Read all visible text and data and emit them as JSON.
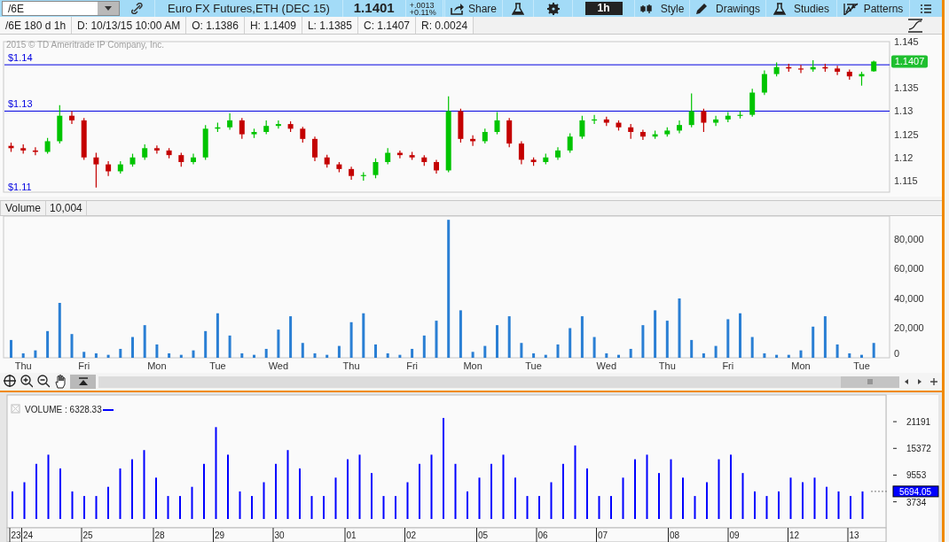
{
  "toolbar": {
    "symbol": "/6E",
    "instrument": "Euro FX Futures,ETH (DEC 15)",
    "last": "1.1401",
    "change": "+.0013",
    "change_pct": "+0.11%",
    "share": "Share",
    "timeframe": "1h",
    "menus": [
      "Style",
      "Drawings",
      "Studies",
      "Patterns"
    ]
  },
  "info_row": [
    "/6E 180 d 1h",
    "D: 10/13/15 10:00 AM",
    "O: 1.1386",
    "H: 1.1409",
    "L: 1.1385",
    "C: 1.1407",
    "R: 0.0024"
  ],
  "price_chart": {
    "copyright": "2015 © TD Ameritrade IP Company, Inc.",
    "price_tag": "1.1407",
    "bottom_label": "$1.11",
    "chart_data": {
      "type": "candlestick",
      "ref_lines": [
        {
          "axis": "y",
          "value": 1.14,
          "label": "$1.14"
        },
        {
          "axis": "y",
          "value": 1.13,
          "label": "$1.13"
        }
      ],
      "ohlc": [
        [
          1.1225,
          1.1232,
          1.1212,
          1.122
        ],
        [
          1.122,
          1.1228,
          1.1208,
          1.1215
        ],
        [
          1.1215,
          1.1222,
          1.1205,
          1.1212
        ],
        [
          1.1212,
          1.1242,
          1.1208,
          1.1235
        ],
        [
          1.1235,
          1.1313,
          1.123,
          1.129
        ],
        [
          1.129,
          1.13,
          1.1272,
          1.128
        ],
        [
          1.128,
          1.1285,
          1.1195,
          1.12
        ],
        [
          1.12,
          1.121,
          1.1135,
          1.1185
        ],
        [
          1.1185,
          1.1192,
          1.116,
          1.117
        ],
        [
          1.117,
          1.1192,
          1.1165,
          1.1185
        ],
        [
          1.1185,
          1.1208,
          1.118,
          1.12
        ],
        [
          1.12,
          1.1228,
          1.1195,
          1.122
        ],
        [
          1.122,
          1.1226,
          1.1208,
          1.1215
        ],
        [
          1.1215,
          1.122,
          1.1198,
          1.1205
        ],
        [
          1.1205,
          1.121,
          1.118,
          1.119
        ],
        [
          1.119,
          1.1208,
          1.1185,
          1.12
        ],
        [
          1.12,
          1.127,
          1.1195,
          1.1262
        ],
        [
          1.1262,
          1.1275,
          1.1255,
          1.1265
        ],
        [
          1.1265,
          1.1295,
          1.126,
          1.128
        ],
        [
          1.128,
          1.1285,
          1.124,
          1.125
        ],
        [
          1.125,
          1.1262,
          1.1242,
          1.1255
        ],
        [
          1.1255,
          1.128,
          1.125,
          1.1268
        ],
        [
          1.1268,
          1.128,
          1.1262,
          1.1272
        ],
        [
          1.1272,
          1.1278,
          1.1255,
          1.1262
        ],
        [
          1.1262,
          1.1266,
          1.1232,
          1.124
        ],
        [
          1.124,
          1.1245,
          1.1192,
          1.12
        ],
        [
          1.12,
          1.1206,
          1.1178,
          1.1185
        ],
        [
          1.1185,
          1.119,
          1.1168,
          1.1175
        ],
        [
          1.1175,
          1.118,
          1.1152,
          1.116
        ],
        [
          1.116,
          1.1168,
          1.115,
          1.1162
        ],
        [
          1.1162,
          1.1198,
          1.1155,
          1.119
        ],
        [
          1.119,
          1.122,
          1.1185,
          1.121
        ],
        [
          1.121,
          1.1215,
          1.1198,
          1.1205
        ],
        [
          1.1205,
          1.1212,
          1.1195,
          1.12
        ],
        [
          1.12,
          1.1205,
          1.1182,
          1.119
        ],
        [
          1.119,
          1.1195,
          1.1165,
          1.1172
        ],
        [
          1.1172,
          1.1332,
          1.1168,
          1.13
        ],
        [
          1.13,
          1.1305,
          1.1232,
          1.124
        ],
        [
          1.124,
          1.1248,
          1.1225,
          1.1235
        ],
        [
          1.1235,
          1.1262,
          1.123,
          1.1255
        ],
        [
          1.1255,
          1.1298,
          1.125,
          1.128
        ],
        [
          1.128,
          1.1285,
          1.1222,
          1.123
        ],
        [
          1.123,
          1.1235,
          1.1185,
          1.1195
        ],
        [
          1.1195,
          1.12,
          1.1182,
          1.119
        ],
        [
          1.119,
          1.1208,
          1.1185,
          1.12
        ],
        [
          1.12,
          1.1222,
          1.1195,
          1.1215
        ],
        [
          1.1215,
          1.1252,
          1.121,
          1.1245
        ],
        [
          1.1245,
          1.129,
          1.124,
          1.128
        ],
        [
          1.128,
          1.1292,
          1.1272,
          1.1282
        ],
        [
          1.1282,
          1.1288,
          1.1268,
          1.1275
        ],
        [
          1.1275,
          1.128,
          1.1258,
          1.1265
        ],
        [
          1.1265,
          1.1272,
          1.124,
          1.1255
        ],
        [
          1.1255,
          1.126,
          1.1238,
          1.1245
        ],
        [
          1.1245,
          1.1258,
          1.124,
          1.125
        ],
        [
          1.125,
          1.1265,
          1.1245,
          1.1258
        ],
        [
          1.1258,
          1.128,
          1.1252,
          1.127
        ],
        [
          1.127,
          1.1338,
          1.1265,
          1.13
        ],
        [
          1.13,
          1.1305,
          1.1255,
          1.1275
        ],
        [
          1.1275,
          1.129,
          1.1268,
          1.1282
        ],
        [
          1.1282,
          1.1298,
          1.1276,
          1.129
        ],
        [
          1.129,
          1.13,
          1.1284,
          1.1292
        ],
        [
          1.1292,
          1.1348,
          1.1288,
          1.134
        ],
        [
          1.134,
          1.1388,
          1.1335,
          1.138
        ],
        [
          1.138,
          1.1405,
          1.1375,
          1.1395
        ],
        [
          1.1395,
          1.1402,
          1.1385,
          1.1392
        ],
        [
          1.1392,
          1.14,
          1.1382,
          1.139
        ],
        [
          1.139,
          1.141,
          1.1385,
          1.1395
        ],
        [
          1.1395,
          1.1402,
          1.1385,
          1.1392
        ],
        [
          1.1392,
          1.1398,
          1.1378,
          1.1385
        ],
        [
          1.1385,
          1.139,
          1.1368,
          1.1375
        ],
        [
          1.1375,
          1.1385,
          1.1355,
          1.138
        ],
        [
          1.1386,
          1.1409,
          1.1385,
          1.1407
        ]
      ],
      "ylim": [
        1.1125,
        1.145
      ],
      "yticks": [
        {
          "value": 1.145,
          "label": "1.145"
        },
        {
          "value": 1.135,
          "label": "1.135"
        },
        {
          "value": 1.13,
          "label": "1.13"
        },
        {
          "value": 1.125,
          "label": "1.125"
        },
        {
          "value": 1.12,
          "label": "1.12"
        },
        {
          "value": 1.115,
          "label": "1.115"
        }
      ]
    }
  },
  "volume_panel": {
    "title": "Volume",
    "value": "10,004",
    "chart_data": {
      "type": "bar",
      "categories": [
        null,
        "Thu",
        null,
        null,
        null,
        null,
        "Fri",
        null,
        null,
        null,
        null,
        null,
        "Mon",
        null,
        null,
        null,
        null,
        "Tue",
        null,
        null,
        null,
        null,
        "Wed",
        null,
        null,
        null,
        null,
        null,
        "Thu",
        null,
        null,
        null,
        null,
        "Fri",
        null,
        null,
        null,
        null,
        "Mon",
        null,
        null,
        null,
        null,
        "Tue",
        null,
        null,
        null,
        null,
        null,
        "Wed",
        null,
        null,
        null,
        null,
        "Thu",
        null,
        null,
        null,
        null,
        "Fri",
        null,
        null,
        null,
        null,
        null,
        "Mon",
        null,
        null,
        null,
        null,
        "Tue",
        null
      ],
      "values": [
        12000,
        3000,
        5000,
        18000,
        37000,
        16000,
        4000,
        3000,
        2000,
        6000,
        14000,
        22000,
        9000,
        3000,
        2000,
        5000,
        18000,
        30000,
        15000,
        3000,
        2000,
        6000,
        19000,
        28000,
        10000,
        3000,
        2000,
        8000,
        24000,
        30000,
        9000,
        3000,
        2000,
        6000,
        15000,
        25000,
        93000,
        32000,
        4000,
        8000,
        22000,
        28000,
        10000,
        3000,
        2000,
        9000,
        20000,
        28000,
        14000,
        3000,
        2000,
        6000,
        22000,
        32000,
        25000,
        40000,
        12000,
        3000,
        8000,
        26000,
        30000,
        14000,
        3000,
        2000,
        2000,
        5000,
        21000,
        28000,
        9000,
        3000,
        2000,
        10000
      ],
      "ylim": [
        0,
        95500
      ],
      "yticks": [
        {
          "value": 80000,
          "label": "80,000"
        },
        {
          "value": 60000,
          "label": "60,000"
        },
        {
          "value": 40000,
          "label": "40,000"
        },
        {
          "value": 20000,
          "label": "20,000"
        },
        0
      ]
    }
  },
  "lower_panel": {
    "legend": "VOLUME : 6328.33",
    "tag": "5694.05",
    "chart_data": {
      "type": "bar",
      "categories": [
        "23",
        "24",
        null,
        null,
        null,
        null,
        "25",
        null,
        null,
        null,
        null,
        null,
        "28",
        null,
        null,
        null,
        null,
        "29",
        null,
        null,
        null,
        null,
        "30",
        null,
        null,
        null,
        null,
        null,
        "01",
        null,
        null,
        null,
        null,
        "02",
        null,
        null,
        null,
        null,
        null,
        "05",
        null,
        null,
        null,
        null,
        "06",
        null,
        null,
        null,
        null,
        "07",
        null,
        null,
        null,
        null,
        null,
        "08",
        null,
        null,
        null,
        null,
        "09",
        null,
        null,
        null,
        null,
        "12",
        null,
        null,
        null,
        null,
        "13",
        null
      ],
      "values": [
        6000,
        8000,
        12000,
        14000,
        11000,
        6000,
        5000,
        5000,
        7000,
        11000,
        13000,
        15000,
        9000,
        5000,
        5000,
        7000,
        12000,
        20000,
        14000,
        6000,
        5000,
        8000,
        12000,
        15000,
        11000,
        5000,
        5000,
        9000,
        13000,
        14000,
        10000,
        5000,
        5000,
        8000,
        12000,
        14000,
        22000,
        12000,
        6000,
        9000,
        12000,
        14000,
        9000,
        5000,
        5000,
        8000,
        12000,
        16000,
        11000,
        5000,
        5000,
        9000,
        13000,
        14000,
        10000,
        13000,
        9000,
        5000,
        8000,
        13000,
        14000,
        10000,
        6000,
        5000,
        6000,
        9000,
        8000,
        9000,
        7000,
        6000,
        5000,
        6000
      ],
      "ylim": [
        0,
        27000
      ],
      "yticks": [
        21191,
        15372,
        9553,
        3734
      ]
    }
  }
}
